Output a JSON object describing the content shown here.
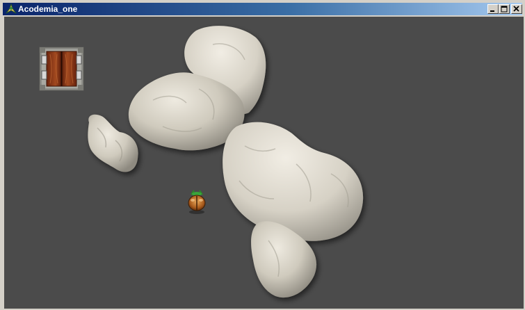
{
  "window": {
    "title": "Acodemia_one",
    "controls": [
      "minimize",
      "maximize",
      "close"
    ]
  },
  "scene": {
    "background_color": "#4b4b4b",
    "objects": [
      {
        "kind": "door",
        "icon": "wooden-double-door-icon"
      },
      {
        "kind": "rock",
        "icon": "small-boulder-icon"
      },
      {
        "kind": "rock",
        "icon": "large-boulder-cluster-icon"
      },
      {
        "kind": "rock",
        "icon": "lower-boulder-cluster-icon"
      },
      {
        "kind": "player",
        "icon": "beetle-character-icon"
      }
    ]
  }
}
